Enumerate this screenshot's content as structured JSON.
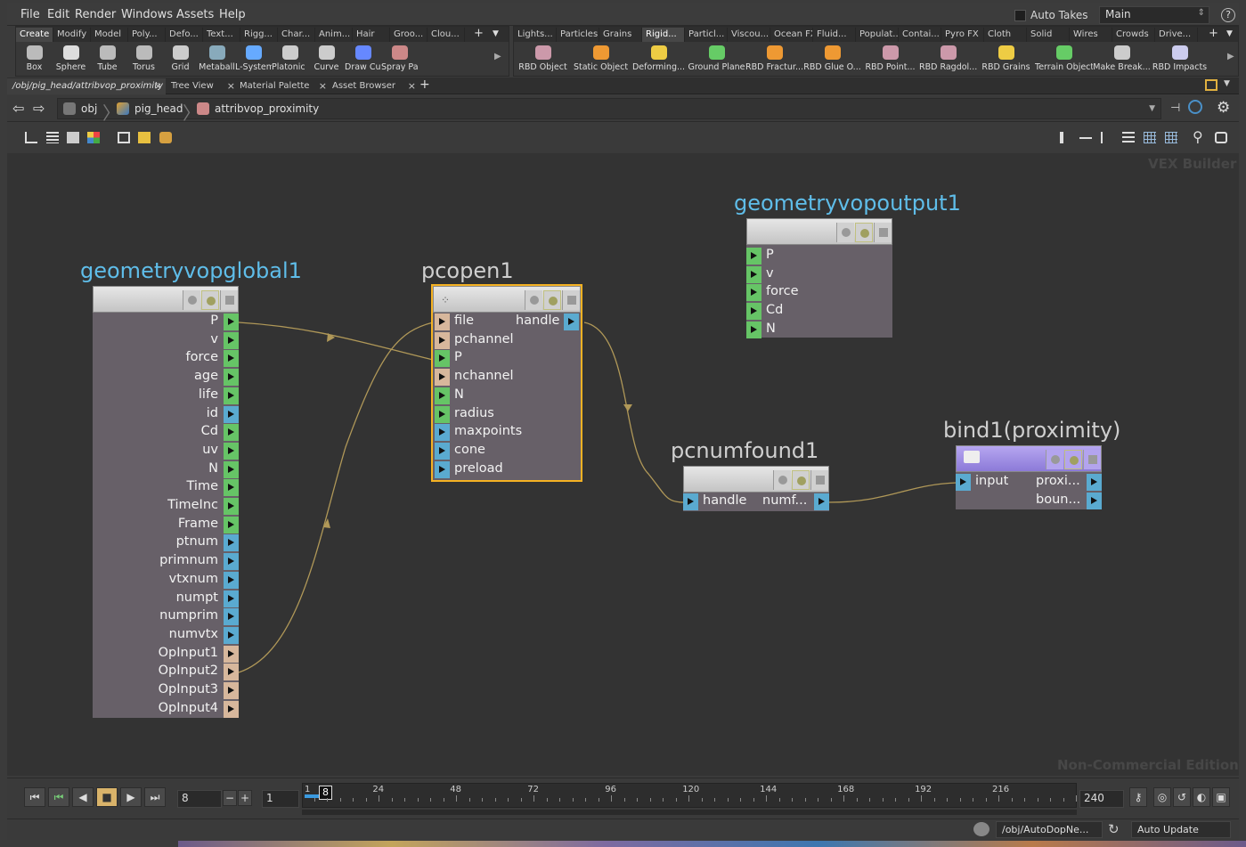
{
  "menu": [
    "File",
    "Edit",
    "Render",
    "Windows",
    "Assets",
    "Help"
  ],
  "auto_takes": "Auto Takes",
  "desktop": "Main",
  "help": "?",
  "shelf_left": {
    "tabs": [
      "Create",
      "Modify",
      "Model",
      "Poly...",
      "Defo...",
      "Text...",
      "Rigg...",
      "Char...",
      "Anim...",
      "Hair",
      "Groo...",
      "Clou..."
    ],
    "tools": [
      "Box",
      "Sphere",
      "Tube",
      "Torus",
      "Grid",
      "Metaball",
      "L-System",
      "Platonic Sol...",
      "Curve",
      "Draw Curve",
      "Spray Paint"
    ]
  },
  "shelf_right": {
    "tabs": [
      "Lights...",
      "Particles",
      "Grains",
      "Rigid...",
      "Particl...",
      "Viscou...",
      "Ocean FX",
      "Fluid...",
      "Populat...",
      "Contai...",
      "Pyro FX",
      "Cloth",
      "Solid",
      "Wires",
      "Crowds",
      "Drive..."
    ],
    "tools": [
      "RBD Object",
      "Static Object",
      "Deforming...",
      "Ground Plane",
      "RBD Fractur...",
      "RBD Glue O...",
      "RBD Point...",
      "RBD Ragdol...",
      "RBD Grains",
      "Terrain Object",
      "Make Break...",
      "RBD Impacts"
    ]
  },
  "pane_tabs": [
    "/obj/pig_head/attribvop_proximity",
    "Tree View",
    "Material Palette",
    "Asset Browser"
  ],
  "path": [
    "obj",
    "pig_head",
    "attribvop_proximity"
  ],
  "watermarks": {
    "top": "VEX Builder",
    "bottom": "Non-Commercial Edition"
  },
  "nodes": {
    "global": {
      "title": "geometryvopglobal1",
      "outputs": [
        "P",
        "v",
        "force",
        "age",
        "life",
        "id",
        "Cd",
        "uv",
        "N",
        "Time",
        "TimeInc",
        "Frame",
        "ptnum",
        "primnum",
        "vtxnum",
        "numpt",
        "numprim",
        "numvtx",
        "OpInput1",
        "OpInput2",
        "OpInput3",
        "OpInput4"
      ],
      "colors": [
        "green",
        "green",
        "green",
        "green",
        "green",
        "blue",
        "green",
        "green",
        "green",
        "green",
        "green",
        "green",
        "blue",
        "blue",
        "blue",
        "blue",
        "blue",
        "blue",
        "tan",
        "tan",
        "tan",
        "tan"
      ]
    },
    "pcopen": {
      "title": "pcopen1",
      "inputs": [
        "file",
        "pchannel",
        "P",
        "nchannel",
        "N",
        "radius",
        "maxpoints",
        "cone",
        "preload"
      ],
      "colors": [
        "tan",
        "tan",
        "green",
        "tan",
        "green",
        "green",
        "blue",
        "blue",
        "blue"
      ],
      "output": "handle"
    },
    "output": {
      "title": "geometryvopoutput1",
      "inputs": [
        "P",
        "v",
        "force",
        "Cd",
        "N"
      ]
    },
    "pcnumfound": {
      "title": "pcnumfound1",
      "input": "handle",
      "output": "numf..."
    },
    "bind": {
      "title": "bind1",
      "subtitle": "(proximity)",
      "input": "input",
      "outputs": [
        "proxi...",
        "boun..."
      ]
    }
  },
  "timeline": {
    "current_frame": "8",
    "start": "1",
    "end": "240",
    "ticks": [
      "1",
      "24",
      "48",
      "72",
      "96",
      "120",
      "144",
      "168",
      "192",
      "216"
    ],
    "indicator": "8"
  },
  "status": {
    "path": "/obj/AutoDopNe...",
    "update_mode": "Auto Update"
  }
}
